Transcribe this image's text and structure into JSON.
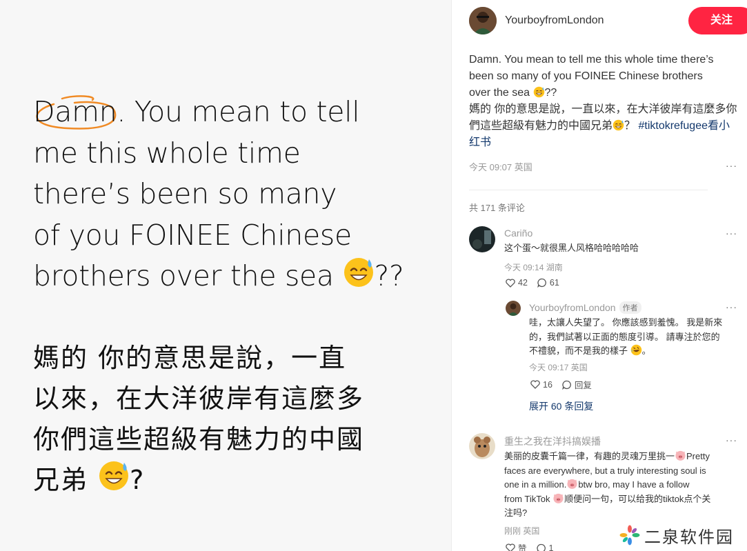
{
  "image_panel": {
    "english_lines": [
      "Damn. You mean to tell",
      "me this whole time",
      "there’s been so many",
      "of you FOINEE Chinese",
      "brothers over the sea"
    ],
    "english_end": "??",
    "chinese_lines": [
      "媽的 你的意思是說，一直",
      "以來，在大洋彼岸有這麼多",
      "你們這些超級有魅力的中國"
    ],
    "chinese_last": "兄弟",
    "chinese_end": "?"
  },
  "post": {
    "author": "YourboyfromLondon",
    "follow_label": "关注",
    "text_en_1": "Damn. You mean to tell me this whole time there’s",
    "text_en_2": "been so many of you FOINEE Chinese brothers",
    "text_en_3": "over the sea",
    "text_en_3_end": "??",
    "text_zh_1": "媽的 你的意思是說，一直以來，在大洋彼岸有這麼多你",
    "text_zh_2a": "們這些超級有魅力的中國兄弟",
    "text_zh_2b": "？",
    "hashtag_a": "#tiktokrefugee看小",
    "hashtag_b": "红书",
    "meta": "今天 09:07 英国",
    "more": "···"
  },
  "comments": {
    "count_label": "共 171 条评论",
    "c1": {
      "name": "Cariño",
      "text": "这个蛋～就很黑人风格哈哈哈哈哈",
      "date": "今天 09:14 湖南",
      "likes": "42",
      "replies": "61",
      "more": "···"
    },
    "reply1": {
      "name": "YourboyfromLondon",
      "tag": "作者",
      "line1": "哇，太讓人失望了。 你應該感到羞愧。 我是新來",
      "line2": "的，我們試著以正面的態度引導。 請專注於您的",
      "line3": "不禮貌，而不是我的樣子",
      "line3_end": "。",
      "date": "今天 09:17 英国",
      "likes": "16",
      "reply_label": "回复",
      "more": "···"
    },
    "expand_label": "展开 60 条回复",
    "c2": {
      "name": "重生之我在洋抖搞娱播",
      "line1": "美丽的皮囊千篇一律，有趣的灵魂万里挑一",
      "line1_end": "Pretty",
      "line2": "faces are everywhere, but a truly interesting soul is",
      "line3": "one in a million.",
      "line3_end": "btw bro, may I have a follow",
      "line4": "from TikTok",
      "line4_end": "顺便问一句，可以给我的tiktok点个关",
      "line5": "注吗?",
      "date": "刚刚 英国",
      "likes": "赞",
      "replies": "1",
      "more": "···"
    }
  },
  "watermark": {
    "text": "二泉软件园"
  }
}
